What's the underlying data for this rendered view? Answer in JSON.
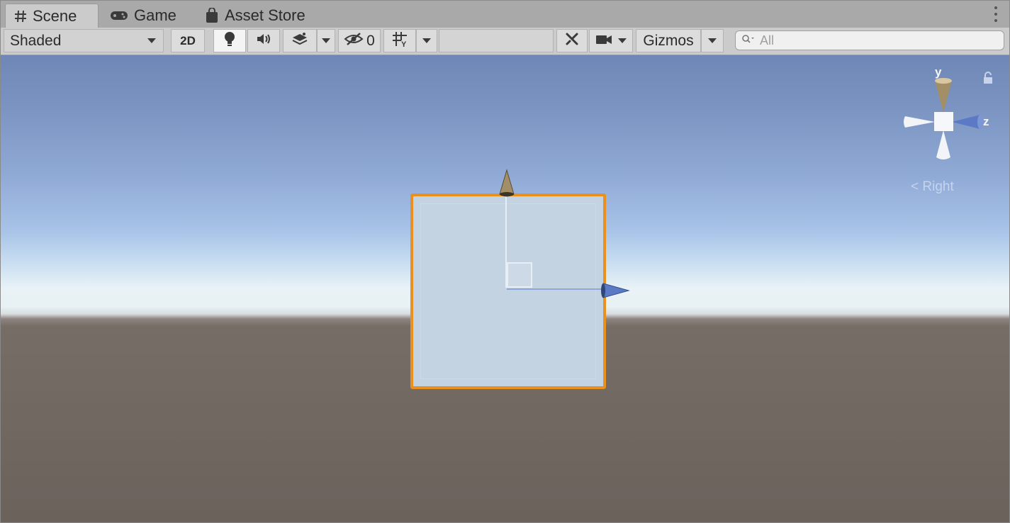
{
  "tabs": [
    {
      "label": "Scene",
      "icon": "hash-icon",
      "active": true
    },
    {
      "label": "Game",
      "icon": "gamepad-icon",
      "active": false
    },
    {
      "label": "Asset Store",
      "icon": "shopping-bag-icon",
      "active": false
    }
  ],
  "toolbar": {
    "draw_mode": "Shaded",
    "mode_2d": "2D",
    "hidden_count": "0",
    "gizmos_label": "Gizmos",
    "search_placeholder": "All",
    "lighting_enabled": true
  },
  "scene": {
    "view_label": "< Right",
    "gizmo_axes": {
      "y": "y",
      "z": "z"
    },
    "selection_color": "#e9901f",
    "axis_colors": {
      "y": "#a38f67",
      "x": "#5b79c4",
      "z": "#5b79c4"
    }
  }
}
